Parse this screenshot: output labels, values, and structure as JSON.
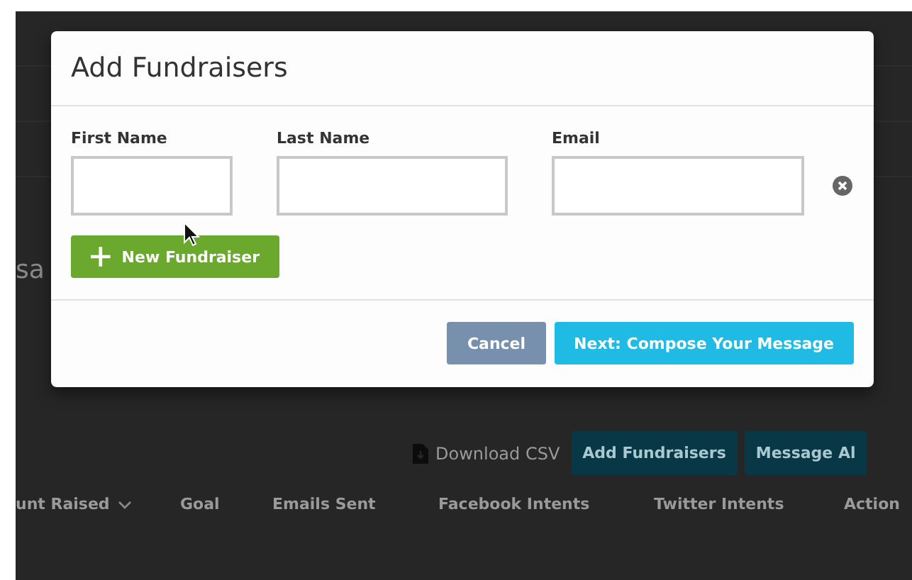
{
  "background_page": {
    "partial_text": "sa",
    "toolbar": {
      "download_link": "Download CSV",
      "buttons": [
        "Add Fundraisers",
        "Message Al"
      ]
    },
    "table": {
      "columns": [
        {
          "label": "unt Raised",
          "sorted": true
        },
        {
          "label": "Goal",
          "sorted": false
        },
        {
          "label": "Emails Sent",
          "sorted": false
        },
        {
          "label": "Facebook Intents",
          "sorted": false
        },
        {
          "label": "Twitter Intents",
          "sorted": false
        },
        {
          "label": "Action",
          "sorted": false
        }
      ]
    }
  },
  "dialog": {
    "title": "Add Fundraisers",
    "fields": [
      {
        "label": "First Name",
        "kind": "short"
      },
      {
        "label": "Last Name",
        "kind": "medium"
      },
      {
        "label": "Email",
        "kind": "long"
      }
    ],
    "add_button": "New Fundraiser",
    "cancel_button": "Cancel",
    "next_button": "Next: Compose Your Message"
  }
}
